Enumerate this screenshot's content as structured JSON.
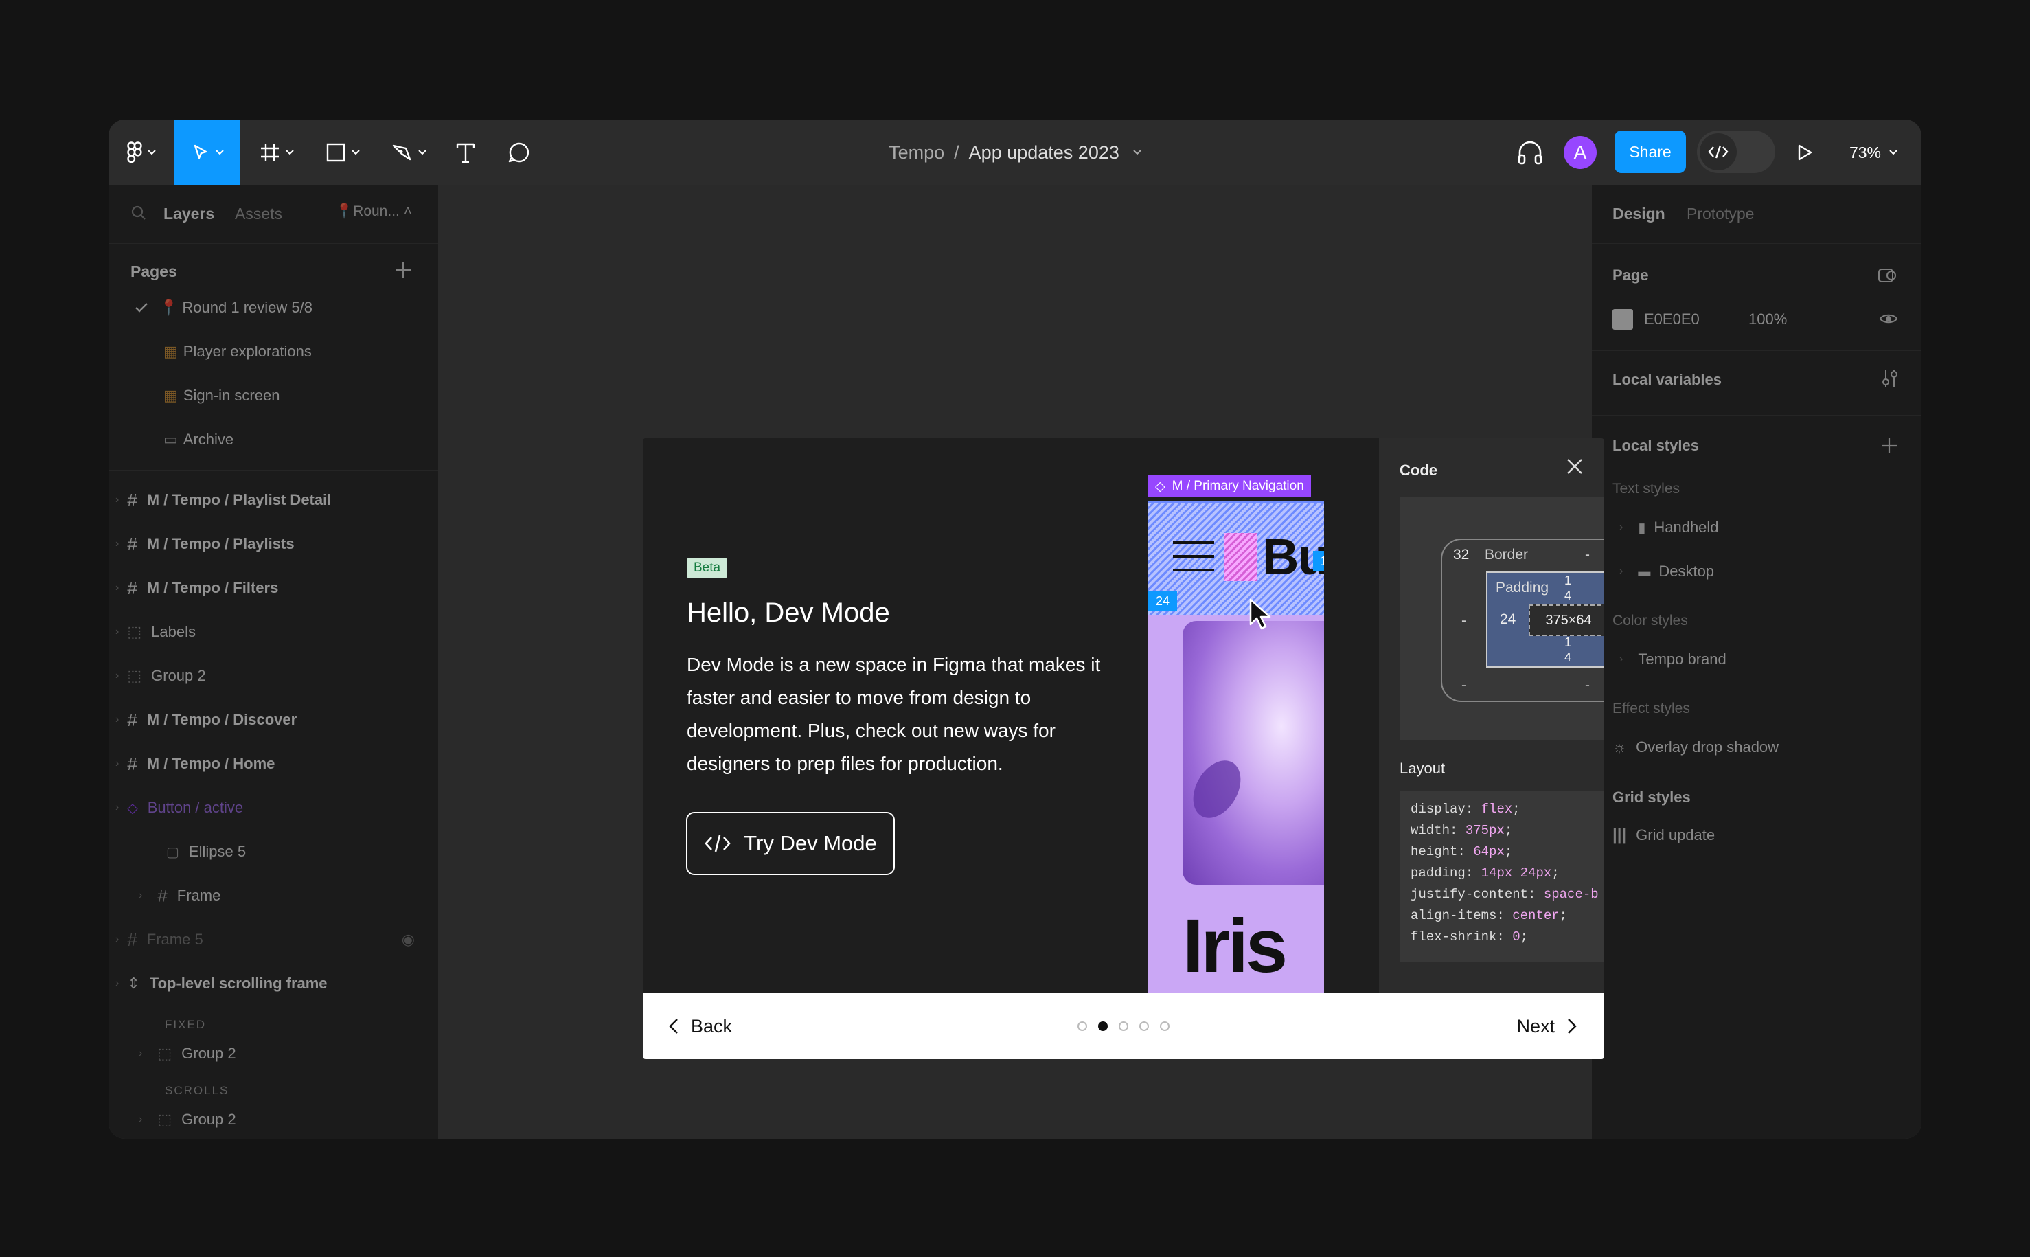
{
  "toolbar": {
    "breadcrumb_project": "Tempo",
    "breadcrumb_sep": "/",
    "breadcrumb_file": "App updates 2023",
    "avatar_letter": "A",
    "share_label": "Share",
    "zoom": "73%"
  },
  "left_panel": {
    "tab_layers": "Layers",
    "tab_assets": "Assets",
    "page_chip": "Roun...",
    "pages_title": "Pages",
    "pages": [
      "Round 1 review 5/8",
      "Player explorations",
      "Sign-in screen",
      "Archive"
    ],
    "layers": [
      {
        "name": "M / Tempo / Playlist Detail",
        "bold": true
      },
      {
        "name": "M / Tempo / Playlists",
        "bold": true
      },
      {
        "name": "M / Tempo / Filters",
        "bold": true
      },
      {
        "name": "Labels",
        "bold": false
      },
      {
        "name": "Group 2",
        "bold": false
      },
      {
        "name": "M / Tempo / Discover",
        "bold": true
      },
      {
        "name": "M / Tempo / Home",
        "bold": true
      },
      {
        "name": "Button / active",
        "bold": false
      },
      {
        "name": "Ellipse 5",
        "bold": false
      },
      {
        "name": "Frame",
        "bold": false
      },
      {
        "name": "Frame 5",
        "bold": false
      },
      {
        "name": "Top-level scrolling frame",
        "bold": true
      },
      {
        "name": "FIXED",
        "bold": false
      },
      {
        "name": "Group 2",
        "bold": false
      },
      {
        "name": "SCROLLS",
        "bold": false
      },
      {
        "name": "Group 2",
        "bold": false
      }
    ]
  },
  "right_panel": {
    "tab_design": "Design",
    "tab_prototype": "Prototype",
    "page_label": "Page",
    "page_color": "E0E0E0",
    "page_opacity": "100%",
    "local_variables": "Local variables",
    "local_styles": "Local styles",
    "text_styles": "Text styles",
    "text_style_items": [
      "Handheld",
      "Desktop"
    ],
    "color_styles": "Color styles",
    "color_style_items": [
      "Tempo brand"
    ],
    "effect_styles": "Effect styles",
    "effect_style_items": [
      "Overlay drop shadow"
    ],
    "grid_styles": "Grid styles",
    "grid_style_items": [
      "Grid update"
    ]
  },
  "modal": {
    "badge": "Beta",
    "title": "Hello, Dev Mode",
    "body": "Dev Mode is a new space in Figma that makes it faster and easier to move from design to development. Plus, check out new ways for designers to prep files for production.",
    "cta": "Try Dev Mode",
    "back": "Back",
    "next": "Next",
    "step_total": 5,
    "step_active": 2,
    "preview": {
      "component_tag": "M / Primary Navigation",
      "pad_top": "14",
      "pad_bottom": "14",
      "pad_left": "24",
      "brand_text": "Butter",
      "big_text": "Iris Ret"
    },
    "code": {
      "title": "Code",
      "border_label": "Border",
      "border_value": "32",
      "dash": "-",
      "padding_label": "Padding",
      "padding_left": "24",
      "padding_top": "1\n4",
      "size": "375×64",
      "layout_label": "Layout",
      "lines": [
        {
          "prop": "display",
          "val": "flex"
        },
        {
          "prop": "width",
          "val": "375px"
        },
        {
          "prop": "height",
          "val": "64px"
        },
        {
          "prop": "padding",
          "val": "14px 24px"
        },
        {
          "prop": "justify-content",
          "val": "space-b"
        },
        {
          "prop": "align-items",
          "val": "center"
        },
        {
          "prop": "flex-shrink",
          "val": "0"
        }
      ]
    }
  },
  "colors": {
    "accent": "#0d99ff",
    "avatar": "#9747ff",
    "component_purple": "#9747ff",
    "hatch_blue": "#6e8bff"
  }
}
